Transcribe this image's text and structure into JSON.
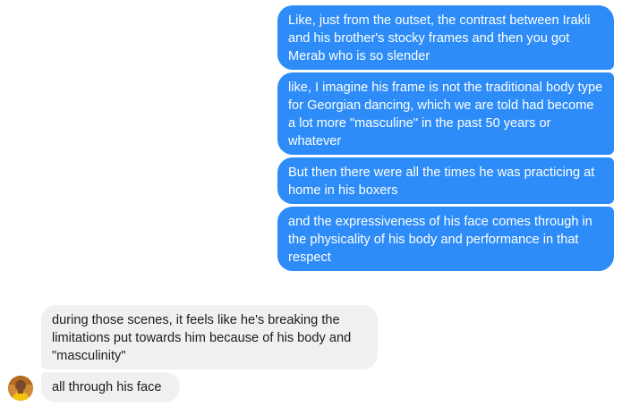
{
  "conversation": {
    "outgoing": [
      "Like, just from the outset, the contrast between Irakli and his brother's stocky frames and then you got Merab who is so slender",
      "like, I imagine his frame is not the traditional body type for Georgian dancing, which we are told had become a lot more \"masculine\" in the past 50 years or whatever",
      "But then there were all the times he was practicing at home in his boxers",
      "and the expressiveness of his face comes through in the physicality of his body and performance in that respect"
    ],
    "incoming": [
      "during those scenes, it feels like he's breaking the limitations put towards him because of his body and \"masculinity\"",
      "all through his face"
    ]
  },
  "colors": {
    "outgoing_bubble": "#2d8cf7",
    "incoming_bubble": "#f0f0f0"
  }
}
